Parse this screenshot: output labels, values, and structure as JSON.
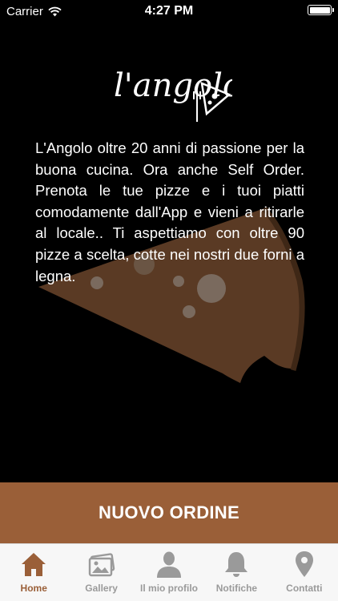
{
  "status_bar": {
    "carrier": "Carrier",
    "time": "4:27 PM",
    "battery_level": 1.0
  },
  "logo": {
    "text": "l'angolo",
    "icon": "pizza-slice-icon"
  },
  "intro": {
    "text": "L'Angolo oltre 20 anni di passione per la buona cucina. Ora anche Self Order. Prenota le tue pizze e i tuoi piatti comodamente dall'App e vieni a ritirarle al locale.. Ti aspettiamo con oltre 90 pizze a scelta, cotte nei nostri due forni a legna."
  },
  "order_button": {
    "label": "NUOVO ORDINE"
  },
  "tabs": [
    {
      "label": "Home",
      "icon": "home-icon",
      "active": true
    },
    {
      "label": "Gallery",
      "icon": "gallery-icon",
      "active": false
    },
    {
      "label": "Il mio profilo",
      "icon": "profile-icon",
      "active": false
    },
    {
      "label": "Notifiche",
      "icon": "bell-icon",
      "active": false
    },
    {
      "label": "Contatti",
      "icon": "location-pin-icon",
      "active": false
    }
  ],
  "colors": {
    "background": "#000000",
    "accent": "#9a5f38",
    "tab_inactive": "#9a9a9a",
    "tab_bar": "#f7f7f7",
    "pizza_watermark": "#5a3a24"
  }
}
